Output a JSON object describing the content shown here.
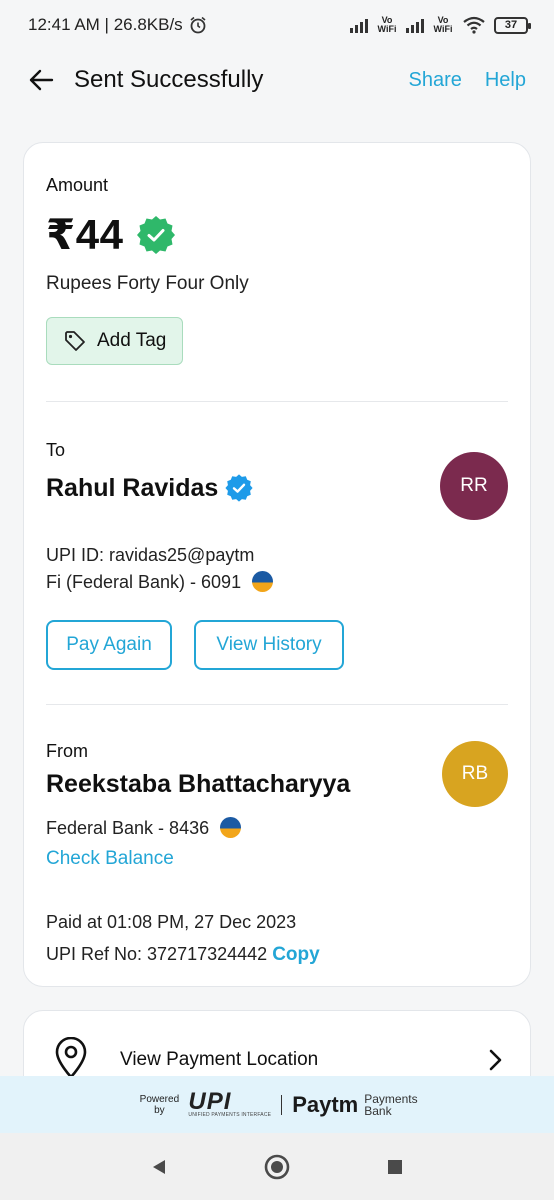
{
  "status_bar": {
    "time_speed": "12:41 AM | 26.8KB/s",
    "vowifi_1": "Vo WiFi",
    "vowifi_2": "Vo WiFi",
    "battery": "37"
  },
  "header": {
    "title": "Sent Successfully",
    "share": "Share",
    "help": "Help"
  },
  "amount": {
    "label": "Amount",
    "value": "₹44",
    "words": "Rupees Forty Four Only",
    "tag_button": "Add Tag"
  },
  "to": {
    "label": "To",
    "name": "Rahul Ravidas",
    "initials": "RR",
    "avatar_color": "#7b2a4e",
    "upi_id": "UPI ID: ravidas25@paytm",
    "bank": "Fi (Federal Bank) - 6091",
    "pay_again": "Pay Again",
    "view_history": "View History"
  },
  "from": {
    "label": "From",
    "name": "Reekstaba Bhattacharyya",
    "initials": "RB",
    "avatar_color": "#d8a420",
    "bank": "Federal Bank - 8436",
    "check_balance": "Check Balance",
    "paid_at": "Paid at 01:08 PM, 27 Dec 2023",
    "ref_no": "UPI Ref No: 372717324442",
    "copy": "Copy"
  },
  "location": {
    "label": "View Payment Location"
  },
  "footer": {
    "powered_by": "Powered by",
    "upi": "UPI",
    "upi_sub": "UNIFIED PAYMENTS INTERFACE",
    "paytm": "Paytm",
    "payments": "Payments",
    "bank": "Bank"
  },
  "colors": {
    "accent": "#23a6d6",
    "success_green": "#2fb86a",
    "verified_blue": "#1e9be9"
  }
}
